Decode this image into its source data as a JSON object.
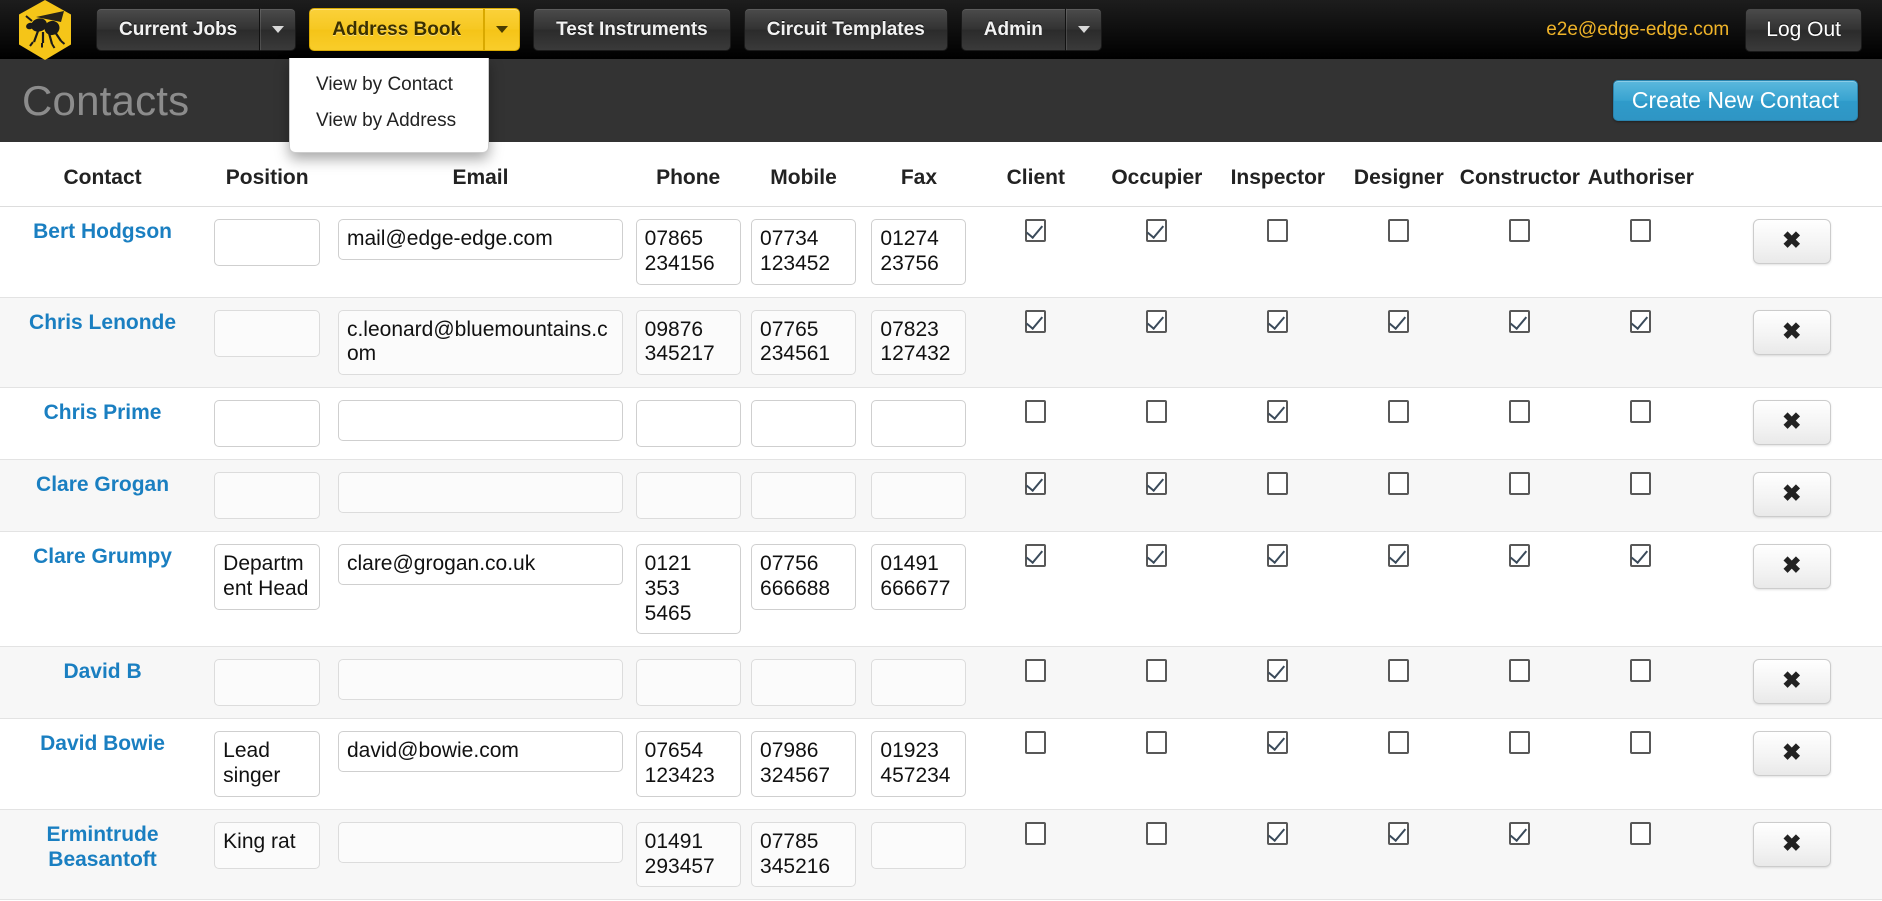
{
  "brand": {
    "logo_icon": "bee-hexagon-logo"
  },
  "nav": {
    "items": [
      {
        "label": "Current Jobs",
        "has_caret": true,
        "active": false
      },
      {
        "label": "Address Book",
        "has_caret": true,
        "active": true
      },
      {
        "label": "Test Instruments",
        "has_caret": false,
        "active": false
      },
      {
        "label": "Circuit Templates",
        "has_caret": false,
        "active": false
      },
      {
        "label": "Admin",
        "has_caret": true,
        "active": false
      }
    ],
    "user_email": "e2e@edge-edge.com",
    "logout_label": "Log Out",
    "caret_icon": "chevron-down-icon"
  },
  "dropdown": {
    "open_for": "Address Book",
    "items": [
      {
        "label": "View by Contact"
      },
      {
        "label": "View by Address"
      }
    ]
  },
  "page": {
    "title": "Contacts",
    "create_button": "Create New Contact"
  },
  "table": {
    "headers": [
      "Contact",
      "Position",
      "Email",
      "Phone",
      "Mobile",
      "Fax",
      "Client",
      "Occupier",
      "Inspector",
      "Designer",
      "Constructor",
      "Authoriser"
    ],
    "delete_icon": "close-x-icon",
    "rows": [
      {
        "name": "Bert Hodgson",
        "position": "",
        "email": "mail@edge-edge.com",
        "phone": "07865 234156",
        "mobile": "07734 123452",
        "fax": "01274 23756",
        "client": true,
        "occupier": true,
        "inspector": false,
        "designer": false,
        "constructor": false,
        "authoriser": false
      },
      {
        "name": "Chris Lenonde",
        "position": "",
        "email": "c.leonard@bluemountains.com",
        "phone": "09876 345217",
        "mobile": "07765 234561",
        "fax": "07823 127432",
        "client": true,
        "occupier": true,
        "inspector": true,
        "designer": true,
        "constructor": true,
        "authoriser": true
      },
      {
        "name": "Chris Prime",
        "position": "",
        "email": "",
        "phone": "",
        "mobile": "",
        "fax": "",
        "client": false,
        "occupier": false,
        "inspector": true,
        "designer": false,
        "constructor": false,
        "authoriser": false
      },
      {
        "name": "Clare Grogan",
        "position": "",
        "email": "",
        "phone": "",
        "mobile": "",
        "fax": "",
        "client": true,
        "occupier": true,
        "inspector": false,
        "designer": false,
        "constructor": false,
        "authoriser": false
      },
      {
        "name": "Clare Grumpy",
        "position": "Department Head",
        "email": "clare@grogan.co.uk",
        "phone": "0121 353 5465",
        "mobile": "07756 666688",
        "fax": "01491 666677",
        "client": true,
        "occupier": true,
        "inspector": true,
        "designer": true,
        "constructor": true,
        "authoriser": true
      },
      {
        "name": "David B",
        "position": "",
        "email": "",
        "phone": "",
        "mobile": "",
        "fax": "",
        "client": false,
        "occupier": false,
        "inspector": true,
        "designer": false,
        "constructor": false,
        "authoriser": false
      },
      {
        "name": "David Bowie",
        "position": "Lead singer",
        "email": "david@bowie.com",
        "phone": "07654 123423",
        "mobile": "07986 324567",
        "fax": "01923 457234",
        "client": false,
        "occupier": false,
        "inspector": true,
        "designer": false,
        "constructor": false,
        "authoriser": false
      },
      {
        "name": "Ermintrude Beasantoft",
        "position": "King rat",
        "email": "",
        "phone": "01491 293457",
        "mobile": "07785 345216",
        "fax": "",
        "client": false,
        "occupier": false,
        "inspector": true,
        "designer": true,
        "constructor": true,
        "authoriser": false
      }
    ]
  },
  "colors": {
    "brand_yellow": "#f5c518",
    "nav_dark": "#000000",
    "pagehead": "#333333",
    "link_blue": "#1a7fc1",
    "primary_blue": "#2f9bca",
    "user_email": "#f0b429"
  }
}
